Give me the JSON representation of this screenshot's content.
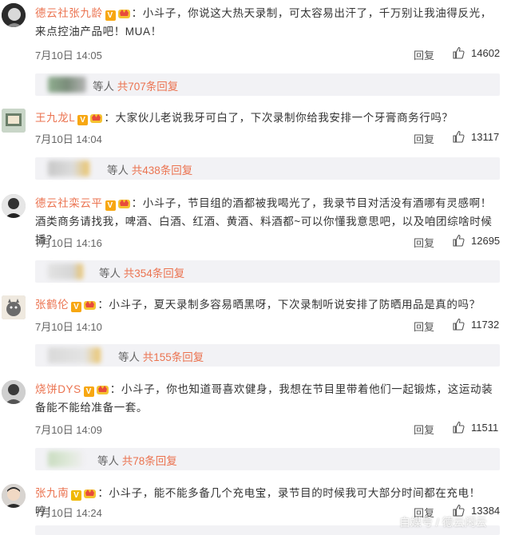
{
  "comments": [
    {
      "username": "德云社张九龄",
      "text": "：小斗子，你说这大热天录制，可太容易出汗了，千万别让我油得反光，来点控油产品吧！MUA！",
      "time": "7月10日 14:05",
      "reply_label": "回复",
      "likes": "14602",
      "sub_prefix": "等人",
      "sub_count": "共707条回复"
    },
    {
      "username": "王九龙L",
      "text": "：大家伙儿老说我牙可白了，下次录制你给我安排一个牙膏商务行吗？",
      "time": "7月10日 14:04",
      "reply_label": "回复",
      "likes": "13117",
      "sub_prefix": "等人",
      "sub_count": "共438条回复"
    },
    {
      "username": "德云社栾云平",
      "text": "：小斗子，节目组的酒都被我喝光了，我录节目对活没有酒哪有灵感啊！酒类商务请找我，啤酒、白酒、红酒、黄酒、料酒都~可以你懂我意思吧，以及咱团综啥时候播？",
      "time": "7月10日 14:16",
      "reply_label": "回复",
      "likes": "12695",
      "sub_prefix": "等人",
      "sub_count": "共354条回复"
    },
    {
      "username": "张鹤伦",
      "text": "：小斗子，夏天录制多容易晒黑呀，下次录制听说安排了防晒用品是真的吗？",
      "time": "7月10日 14:10",
      "reply_label": "回复",
      "likes": "11732",
      "sub_prefix": "等人",
      "sub_count": "共155条回复"
    },
    {
      "username": "烧饼DYS",
      "text": "：小斗子，你也知道哥喜欢健身，我想在节目里带着他们一起锻炼，这运动装备能不能给准备一套。",
      "time": "7月10日 14:09",
      "reply_label": "回复",
      "likes": "11511",
      "sub_prefix": "等人",
      "sub_count": "共78条回复"
    },
    {
      "username": "张九南",
      "text": "：小斗子，能不能多备几个充电宝，录节目的时候我可大部分时间都在充电！哼！",
      "time": "7月10日 14:24",
      "reply_label": "回复",
      "likes": "13384"
    }
  ],
  "watermark": "自媒号 / 德云闲云",
  "colors": {
    "username": "#eb7350",
    "badge": "#f7a712",
    "sub_bg": "#f2f2f5"
  }
}
